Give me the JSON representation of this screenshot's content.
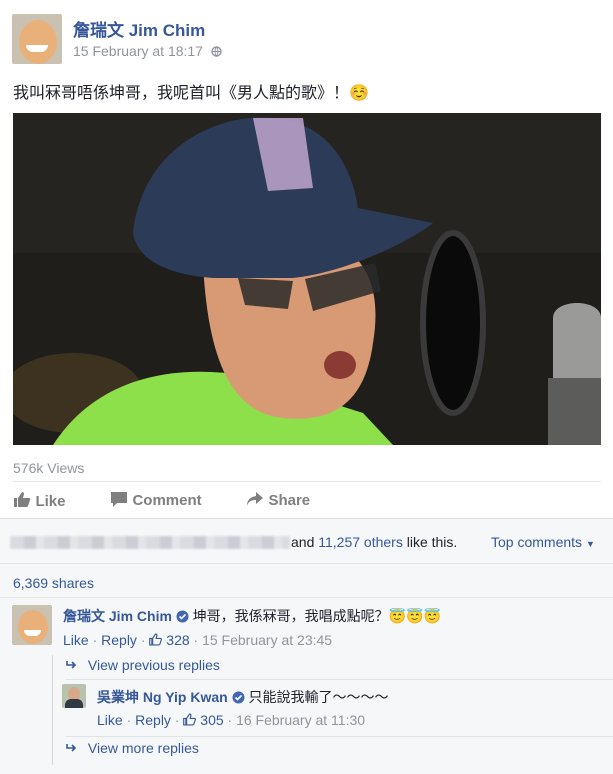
{
  "post": {
    "author_name": "詹瑞文 Jim Chim",
    "timestamp": "15 February at 18:17",
    "message": "我叫冧哥唔係坤哥，我呢首叫《男人點的歌》！☺️",
    "views": "576k Views"
  },
  "actions": {
    "like": "Like",
    "comment": "Comment",
    "share": "Share"
  },
  "likes_summary": {
    "and_text": "and",
    "others_count": "11,257 others",
    "like_this": "like this.",
    "top_comments": "Top comments"
  },
  "shares": "6,369 shares",
  "comment1": {
    "author": "詹瑞文 Jim Chim",
    "text": "坤哥，我係冧哥，我唱成點呢？😇😇😇",
    "like": "Like",
    "reply": "Reply",
    "likes": "328",
    "time": "15 February at 23:45"
  },
  "view_previous_replies": "View previous replies",
  "reply1": {
    "author": "吳業坤 Ng Yip Kwan",
    "text": "只能說我輸了～～～～",
    "like": "Like",
    "reply": "Reply",
    "likes": "305",
    "time": "16 February at 11:30"
  },
  "view_more_replies": "View more replies",
  "colors": {
    "link": "#365899",
    "grey": "#90949c",
    "verified": "#4267b2"
  }
}
